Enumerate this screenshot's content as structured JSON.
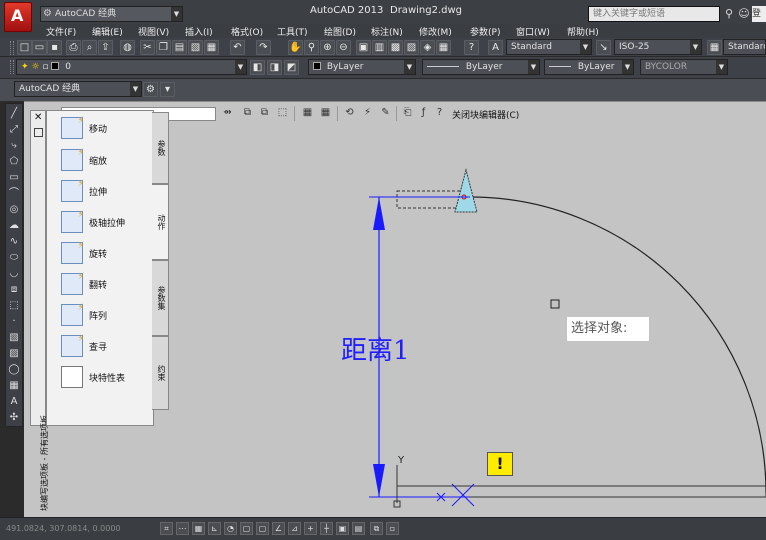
{
  "titlebar": {
    "app_logo": "A",
    "workspace_combo": "AutoCAD 经典",
    "app_name": "AutoCAD 2013",
    "document": "Drawing2.dwg",
    "search_placeholder": "键入关键字或短语",
    "signin_label": "登"
  },
  "menu": [
    "文件(F)",
    "编辑(E)",
    "视图(V)",
    "插入(I)",
    "格式(O)",
    "工具(T)",
    "绘图(D)",
    "标注(N)",
    "修改(M)",
    "参数(P)",
    "窗口(W)",
    "帮助(H)"
  ],
  "toolbar1": {
    "text_style": "Standard",
    "dim_style": "ISO-25",
    "table_style": "Standard"
  },
  "toolbar2": {
    "layer": "0",
    "color": "ByLayer",
    "linetype": "ByLayer",
    "lineweight": "ByLayer",
    "plotstyle": "BYCOLOR"
  },
  "workspace_row": {
    "workspace": "AutoCAD 经典"
  },
  "block_editor": {
    "close_label": "关闭块编辑器(C)"
  },
  "palette": {
    "title": "块编写选项板 - 所有选项板",
    "actions": [
      {
        "label": "移动",
        "icon": "move-action-icon"
      },
      {
        "label": "缩放",
        "icon": "scale-action-icon"
      },
      {
        "label": "拉伸",
        "icon": "stretch-action-icon"
      },
      {
        "label": "极轴拉伸",
        "icon": "polar-stretch-action-icon"
      },
      {
        "label": "旋转",
        "icon": "rotate-action-icon"
      },
      {
        "label": "翻转",
        "icon": "flip-action-icon"
      },
      {
        "label": "阵列",
        "icon": "array-action-icon"
      },
      {
        "label": "查寻",
        "icon": "lookup-action-icon"
      },
      {
        "label": "块特性表",
        "icon": "block-table-icon"
      }
    ],
    "tabs": [
      "参数",
      "动作",
      "参数集",
      "约束"
    ],
    "active_tab": "动作"
  },
  "drawing": {
    "distance_label": "距离1",
    "prompt": "选择对象:",
    "warning_icon": "!",
    "ucs_label": "Y"
  },
  "statusbar": {
    "coords": "491.0824, 307.0814, 0.0000"
  }
}
